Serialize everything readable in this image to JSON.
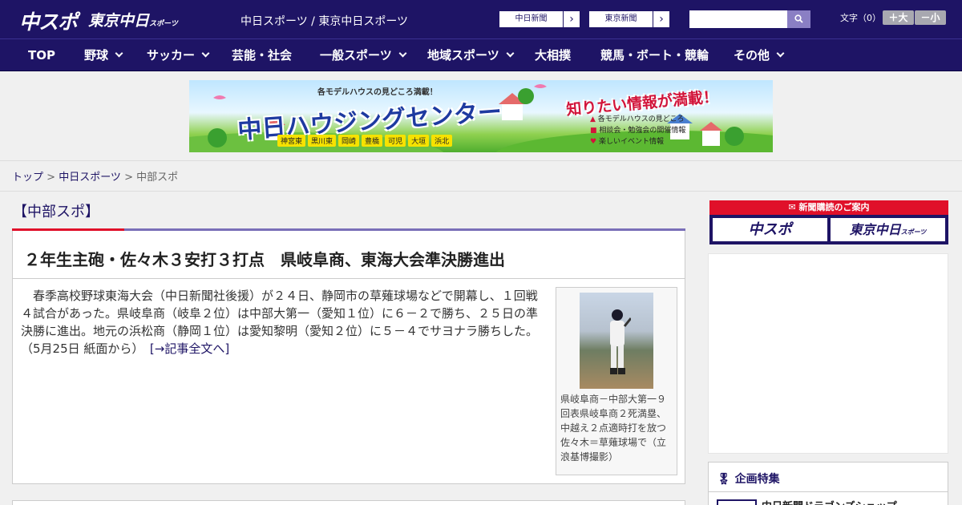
{
  "header": {
    "logo_chunichi": "中スポ",
    "logo_tokyo": "東京中日",
    "logo_tokyo_small": "スポーツ",
    "site_title": "中日スポーツ / 東京中日スポーツ",
    "paper_links": [
      {
        "label": "中日新聞"
      },
      {
        "label": "東京新聞"
      }
    ],
    "search": {
      "placeholder": "",
      "value": ""
    },
    "font_size": {
      "label": "文字（0）",
      "increase": "＋大",
      "decrease": "－小"
    }
  },
  "nav": {
    "items": [
      {
        "label": "TOP"
      },
      {
        "label": "野球"
      },
      {
        "label": "サッカー"
      },
      {
        "label": "芸能・社会"
      },
      {
        "label": "一般スポーツ"
      },
      {
        "label": "地域スポーツ"
      },
      {
        "label": "大相撲"
      },
      {
        "label": "競馬・ボート・競輪"
      },
      {
        "label": "その他"
      }
    ]
  },
  "banner": {
    "subtitle": "各モデルハウスの見どころ満載！",
    "title": "中日ハウジングセンター",
    "slogan": "知りたい情報が満載！",
    "points": [
      "各モデルハウスの見どころ",
      "相談会・勉強会の開催情報",
      "楽しいイベント情報"
    ],
    "cities": [
      "神宮東",
      "黒川東",
      "岡崎",
      "豊橋",
      "可児",
      "大垣",
      "浜北"
    ]
  },
  "breadcrumb": {
    "top": "トップ",
    "sep1": " > ",
    "section": "中日スポーツ",
    "sep2": " > ",
    "current": "中部スポ"
  },
  "section_title": "【中部スポ】",
  "article": {
    "headline": "２年生主砲・佐々木３安打３打点　県岐阜商、東海大会準決勝進出",
    "body": "春季高校野球東海大会（中日新聞社後援）が２４日、静岡市の草薙球場などで開幕し、１回戦４試合があった。県岐阜商（岐阜２位）は中部大第一（愛知１位）に６－２で勝ち、２５日の準決勝に進出。地元の浜松商（静岡１位）は愛知黎明（愛知２位）に５－４でサヨナラ勝ちした。（5月25日 紙面から）",
    "more_link": "[→記事全文へ]",
    "photo_caption": "県岐阜商－中部大第一９回表県岐阜商２死満塁、中越え２点適時打を放つ佐々木＝草薙球場で（立浪基博撮影）"
  },
  "sidebar": {
    "subscribe_header": "新聞購読のご案内",
    "subscribe_chunichi": "中スポ",
    "subscribe_tokyo": "東京中日",
    "subscribe_tokyo_small": "スポーツ",
    "feature_title": "企画特集",
    "feature_item": "中日新聞ドラゴンズショップ"
  },
  "colors": {
    "brand_navy": "#1e1465",
    "accent_red": "#e0102a",
    "accent_purple": "#7a6fb8"
  }
}
